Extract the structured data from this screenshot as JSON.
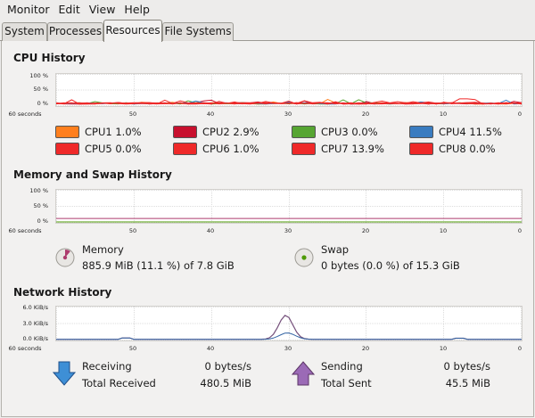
{
  "menubar": {
    "items": [
      "Monitor",
      "Edit",
      "View",
      "Help"
    ]
  },
  "tabs": [
    "System",
    "Processes",
    "Resources",
    "File Systems"
  ],
  "active_tab": "Resources",
  "cpu": {
    "title": "CPU History",
    "y_ticks": [
      "100 %",
      "50 %",
      "0 %"
    ],
    "x_ticks": [
      "60 seconds",
      "50",
      "40",
      "30",
      "20",
      "10",
      "0"
    ],
    "legend": [
      {
        "label": "CPU1",
        "value": "1.0%",
        "color": "#ff7f1e"
      },
      {
        "label": "CPU2",
        "value": "2.9%",
        "color": "#c8102e"
      },
      {
        "label": "CPU3",
        "value": "0.0%",
        "color": "#56a532"
      },
      {
        "label": "CPU4",
        "value": "11.5%",
        "color": "#3a7cc0"
      },
      {
        "label": "CPU5",
        "value": "0.0%",
        "color": "#ef2929"
      },
      {
        "label": "CPU6",
        "value": "1.0%",
        "color": "#ef2929"
      },
      {
        "label": "CPU7",
        "value": "13.9%",
        "color": "#ef2929"
      },
      {
        "label": "CPU8",
        "value": "0.0%",
        "color": "#ef2929"
      }
    ]
  },
  "memory": {
    "title": "Memory and Swap History",
    "y_ticks": [
      "100 %",
      "50 %",
      "0 %"
    ],
    "x_ticks": [
      "60 seconds",
      "50",
      "40",
      "30",
      "20",
      "10",
      "0"
    ],
    "memory_label": "Memory",
    "memory_value": "885.9 MiB (11.1 %) of 7.8 GiB",
    "memory_percent": 11.1,
    "memory_color": "#ad3b6e",
    "swap_label": "Swap",
    "swap_value": "0 bytes (0.0 %) of 15.3 GiB",
    "swap_percent": 0.0,
    "swap_color": "#4e9a06"
  },
  "network": {
    "title": "Network History",
    "y_ticks": [
      "6.0 KiB/s",
      "3.0 KiB/s",
      "0.0 KiB/s"
    ],
    "x_ticks": [
      "60 seconds",
      "50",
      "40",
      "30",
      "20",
      "10",
      "0"
    ],
    "receiving_label": "Receiving",
    "receiving_value": "0 bytes/s",
    "total_received_label": "Total Received",
    "total_received_value": "480.5 MiB",
    "sending_label": "Sending",
    "sending_value": "0 bytes/s",
    "total_sent_label": "Total Sent",
    "total_sent_value": "45.5 MiB",
    "receiving_color": "#3465a4",
    "sending_color": "#75507b"
  }
}
